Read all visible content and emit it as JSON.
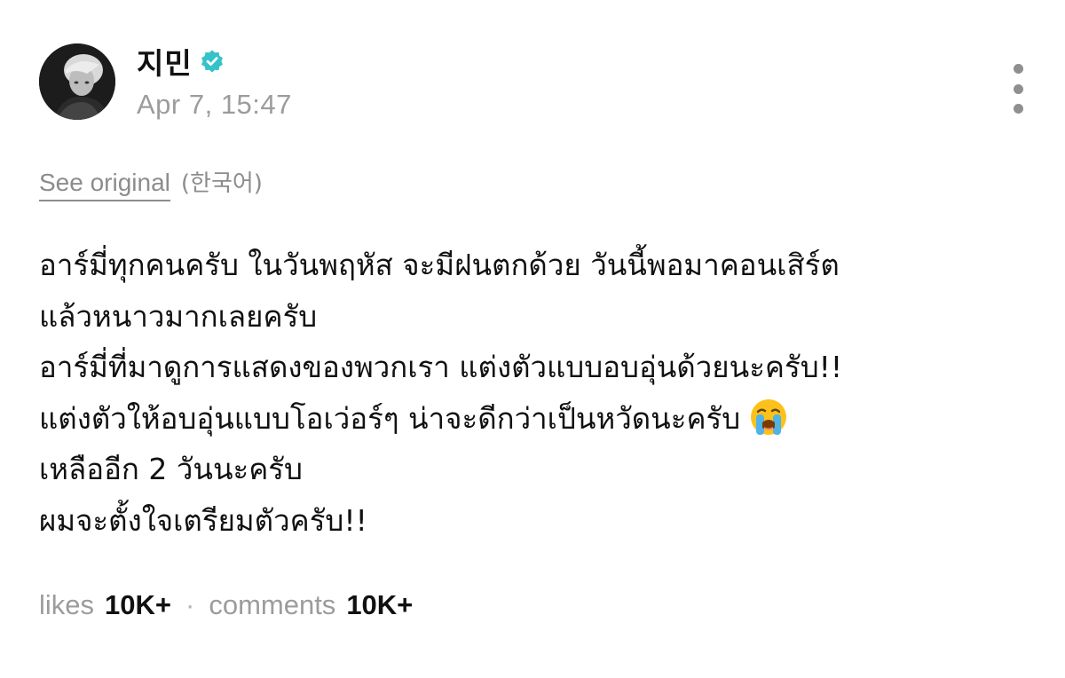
{
  "post": {
    "author": {
      "name": "지민",
      "verified": true
    },
    "timestamp": "Apr 7, 15:47",
    "translation": {
      "see_original_label": "See original",
      "source_language": "(한국어)"
    },
    "body_lines": [
      "อาร์มี่ทุกคนครับ ในวันพฤหัส จะมีฝนตกด้วย วันนี้พอมาคอนเสิร์ต",
      "แล้วหนาวมากเลยครับ",
      "อาร์มี่ที่มาดูการแสดงของพวกเรา แต่งตัวแบบอบอุ่นด้วยนะครับ!!",
      "แต่งตัวให้อบอุ่นแบบโอเว่อร์ๆ น่าจะดีกว่าเป็นหวัดนะครับ",
      "เหลืออีก 2 วันนะครับ",
      "ผมจะตั้งใจเตรียมตัวครับ!!"
    ],
    "emoji": "loudly-crying-face",
    "stats": {
      "likes_label": "likes",
      "likes_value": "10K+",
      "separator": "·",
      "comments_label": "comments",
      "comments_value": "10K+"
    }
  },
  "colors": {
    "verified_badge": "#34c3c9",
    "secondary_text": "#9c9c9c",
    "primary_text": "#111111"
  }
}
